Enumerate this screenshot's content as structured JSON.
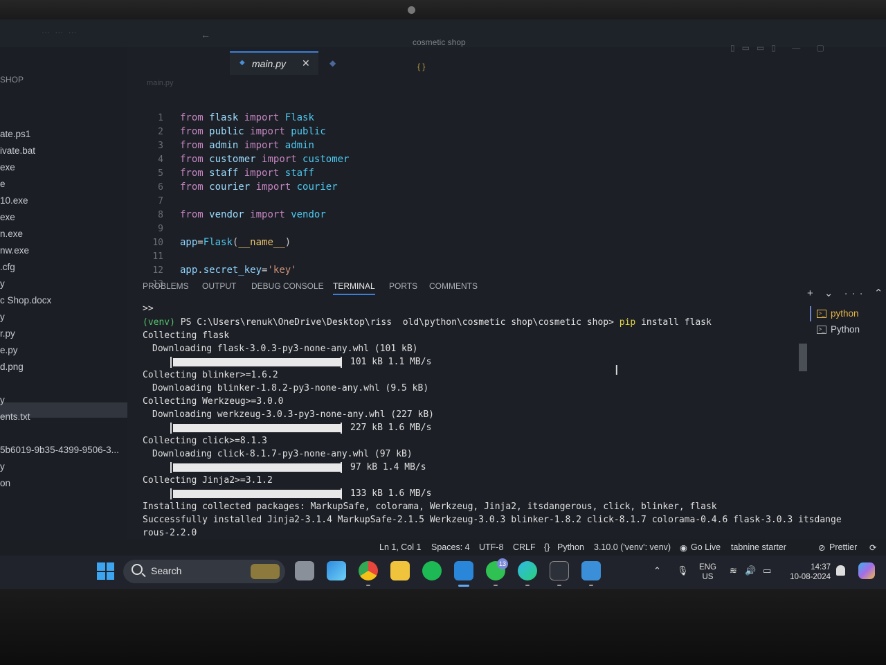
{
  "window": {
    "title": "cosmetic shop"
  },
  "sidebar": {
    "title": "SHOP",
    "items": [
      {
        "label": "ate.ps1"
      },
      {
        "label": "ivate.bat"
      },
      {
        "label": "exe"
      },
      {
        "label": "e"
      },
      {
        "label": "10.exe"
      },
      {
        "label": "exe"
      },
      {
        "label": "n.exe"
      },
      {
        "label": "nw.exe"
      },
      {
        "label": ".cfg"
      },
      {
        "label": "y"
      },
      {
        "label": "c Shop.docx"
      },
      {
        "label": "y"
      },
      {
        "label": "r.py"
      },
      {
        "label": "e.py"
      },
      {
        "label": "d.png"
      },
      {
        "label": "y"
      },
      {
        "label": "ents.txt"
      },
      {
        "label": "5b6019-9b35-4399-9506-3..."
      },
      {
        "label": "y"
      },
      {
        "label": "on"
      }
    ]
  },
  "editor": {
    "tab_name": "main.py",
    "close_glyph": "✕",
    "breadcrumb": "main.py",
    "lines": [
      {
        "n": "1",
        "parts": [
          [
            "kw",
            "from"
          ],
          [
            "plain",
            " "
          ],
          [
            "mod",
            "flask"
          ],
          [
            "plain",
            " "
          ],
          [
            "kw",
            "import"
          ],
          [
            "plain",
            " "
          ],
          [
            "fn",
            "Flask"
          ]
        ]
      },
      {
        "n": "2",
        "parts": [
          [
            "kw",
            "from"
          ],
          [
            "plain",
            " "
          ],
          [
            "mod",
            "public"
          ],
          [
            "plain",
            " "
          ],
          [
            "kw",
            "import"
          ],
          [
            "plain",
            " "
          ],
          [
            "fn",
            "public"
          ]
        ]
      },
      {
        "n": "3",
        "parts": [
          [
            "kw",
            "from"
          ],
          [
            "plain",
            " "
          ],
          [
            "mod",
            "admin"
          ],
          [
            "plain",
            " "
          ],
          [
            "kw",
            "import"
          ],
          [
            "plain",
            " "
          ],
          [
            "fn",
            "admin"
          ]
        ]
      },
      {
        "n": "4",
        "parts": [
          [
            "kw",
            "from"
          ],
          [
            "plain",
            " "
          ],
          [
            "mod",
            "customer"
          ],
          [
            "plain",
            " "
          ],
          [
            "kw",
            "import"
          ],
          [
            "plain",
            " "
          ],
          [
            "fn",
            "customer"
          ]
        ]
      },
      {
        "n": "5",
        "parts": [
          [
            "kw",
            "from"
          ],
          [
            "plain",
            " "
          ],
          [
            "mod",
            "staff"
          ],
          [
            "plain",
            " "
          ],
          [
            "kw",
            "import"
          ],
          [
            "plain",
            " "
          ],
          [
            "fn",
            "staff"
          ]
        ]
      },
      {
        "n": "6",
        "parts": [
          [
            "kw",
            "from"
          ],
          [
            "plain",
            " "
          ],
          [
            "mod",
            "courier"
          ],
          [
            "plain",
            " "
          ],
          [
            "kw",
            "import"
          ],
          [
            "plain",
            " "
          ],
          [
            "fn",
            "courier"
          ]
        ]
      },
      {
        "n": "7",
        "parts": []
      },
      {
        "n": "8",
        "parts": [
          [
            "kw",
            "from"
          ],
          [
            "plain",
            " "
          ],
          [
            "mod",
            "vendor"
          ],
          [
            "plain",
            " "
          ],
          [
            "kw",
            "import"
          ],
          [
            "plain",
            " "
          ],
          [
            "fn",
            "vendor"
          ]
        ]
      },
      {
        "n": "9",
        "parts": []
      },
      {
        "n": "10",
        "parts": [
          [
            "var",
            "app"
          ],
          [
            "plain",
            "="
          ],
          [
            "fn",
            "Flask"
          ],
          [
            "plain",
            "("
          ],
          [
            "dunder",
            "__name__"
          ],
          [
            "plain",
            ")"
          ]
        ]
      },
      {
        "n": "11",
        "parts": []
      },
      {
        "n": "12",
        "parts": [
          [
            "var",
            "app"
          ],
          [
            "plain",
            "."
          ],
          [
            "var",
            "secret_key"
          ],
          [
            "plain",
            "="
          ],
          [
            "str",
            "'key'"
          ]
        ]
      },
      {
        "n": "13",
        "parts": []
      }
    ]
  },
  "panel": {
    "tabs": [
      "PROBLEMS",
      "OUTPUT",
      "DEBUG CONSOLE",
      "TERMINAL",
      "PORTS",
      "COMMENTS"
    ],
    "active_tab": "TERMINAL",
    "actions": "+ ⌄ ··· ⌃ ✕"
  },
  "terminal": {
    "prompt_marker": ">>",
    "venv": "(venv)",
    "prompt_path": " PS C:\\Users\\renuk\\OneDrive\\Desktop\\riss  old\\python\\cosmetic shop\\cosmetic shop> ",
    "cmd_pip": "pip",
    "cmd_rest": " install flask",
    "l_collect_flask": "Collecting flask",
    "l_dl_flask": "Downloading flask-3.0.3-py3-none-any.whl (101 kB)",
    "p_flask": "101 kB 1.1 MB/s",
    "l_collect_blinker": "Collecting blinker>=1.6.2",
    "l_dl_blinker": "Downloading blinker-1.8.2-py3-none-any.whl (9.5 kB)",
    "l_collect_werkzeug": "Collecting Werkzeug>=3.0.0",
    "l_dl_werkzeug": "Downloading werkzeug-3.0.3-py3-none-any.whl (227 kB)",
    "p_werkzeug": "227 kB 1.6 MB/s",
    "l_collect_click": "Collecting click>=8.1.3",
    "l_dl_click": "Downloading click-8.1.7-py3-none-any.whl (97 kB)",
    "p_click": "97 kB 1.4 MB/s",
    "l_collect_jinja": "Collecting Jinja2>=3.1.2",
    "p_jinja": "133 kB 1.6 MB/s",
    "l_installing": "Installing collected packages: MarkupSafe, colorama, Werkzeug, Jinja2, itsdangerous, click, blinker, flask",
    "l_success": "Successfully installed Jinja2-3.1.4 MarkupSafe-2.1.5 Werkzeug-3.0.3 blinker-1.8.2 click-8.1.7 colorama-0.4.6 flask-3.0.3 itsdange",
    "l_success_wrap": "rous-2.2.0",
    "progress_fraction": 1.0
  },
  "terminal_list": {
    "items": [
      "python",
      "Python"
    ]
  },
  "statusbar": {
    "position": "Ln 1, Col 1",
    "spaces": "Spaces: 4",
    "encoding": "UTF-8",
    "eol": "CRLF",
    "language": "Python",
    "interpreter": "3.10.0 ('venv': venv)",
    "golive": "Go Live",
    "tabnine": "tabnine starter",
    "prettier": "Prettier"
  },
  "taskbar": {
    "search_label": "Search",
    "whatsapp_badge": "13",
    "lang_top": "ENG",
    "lang_bottom": "US",
    "time": "14:37",
    "date": "10-08-2024"
  },
  "colors": {
    "accent": "#3c7fd6",
    "venv_green": "#56c26b",
    "pip_yellow": "#e5d64a"
  }
}
